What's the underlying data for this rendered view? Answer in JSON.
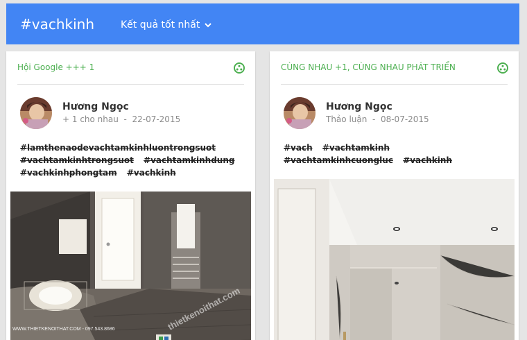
{
  "header": {
    "hashtag": "#vachkinh",
    "sort_label": "Kết quả tốt nhất"
  },
  "posts": [
    {
      "community": "Hội Google +++ 1",
      "author": "Hương Ngọc",
      "activity": "+ 1 cho nhau",
      "date": "22-07-2015",
      "tags": [
        "#lamthenaodevachtamkinhluontrongsuot",
        "#vachtamkinhtrongsuot",
        "#vachtamkinhdung",
        "#vachkinhphongtam",
        "#vachkinh"
      ],
      "photo_caption": "WWW.THIETKENOITHAT.COM - 097.543.8686",
      "photo_watermark": "thietkenoithat.com"
    },
    {
      "community": "CÙNG NHAU +1, CÙNG NHAU PHÁT TRIỂN",
      "author": "Hương Ngọc",
      "activity": "Thảo luận",
      "date": "08-07-2015",
      "tags": [
        "#vach",
        "#vachtamkinh",
        "#vachtamkinhcuongluc",
        "#vachkinh"
      ]
    }
  ],
  "colors": {
    "header": "#4285f4",
    "community": "#4caf50"
  },
  "icons": {
    "sort": "chevron-down-icon",
    "community": "community-icon"
  }
}
